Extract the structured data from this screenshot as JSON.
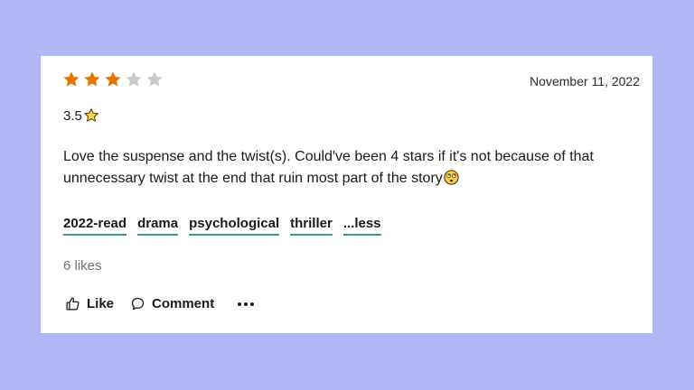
{
  "review": {
    "rating": 3,
    "max_rating": 5,
    "date": "November 11, 2022",
    "score_text": "3.5",
    "body": "Love the suspense and the twist(s). Could've been 4 stars if it's not because of that unnecessary twist at the end that ruin most part of the story",
    "tags": [
      "2022-read",
      "drama",
      "psychological",
      "thriller",
      "...less"
    ],
    "likes": "6 likes",
    "actions": {
      "like_label": "Like",
      "comment_label": "Comment"
    }
  },
  "colors": {
    "background": "#b1b7f6",
    "star_filled": "#e87400",
    "star_empty": "#c9c9c9",
    "tag_underline": "#409d69",
    "likes_text": "#707070"
  },
  "icons": {
    "score": "star-emoji-icon",
    "review_end": "face-with-rolling-eyes-emoji",
    "like": "thumbs-up-icon",
    "comment": "comment-bubble-icon",
    "more": "more-options-icon"
  }
}
